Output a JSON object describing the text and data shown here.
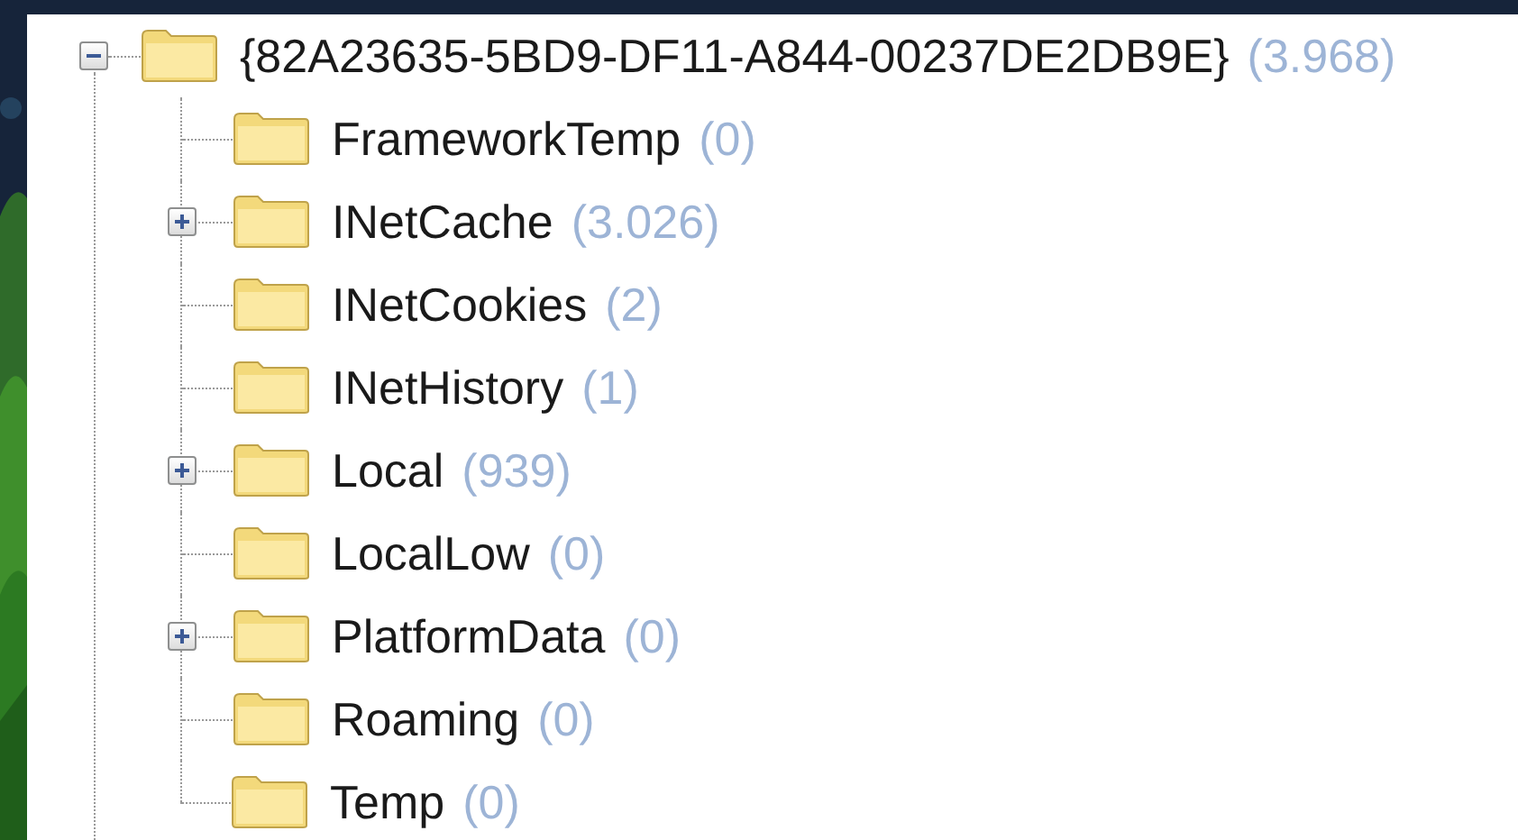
{
  "tree": {
    "name": "{82A23635-5BD9-DF11-A844-00237DE2DB9E}",
    "count": "(3.968)",
    "expanded": true,
    "children": [
      {
        "name": "FrameworkTemp",
        "count": "(0)",
        "expandable": false
      },
      {
        "name": "INetCache",
        "count": "(3.026)",
        "expandable": true
      },
      {
        "name": "INetCookies",
        "count": "(2)",
        "expandable": false
      },
      {
        "name": "INetHistory",
        "count": "(1)",
        "expandable": false
      },
      {
        "name": "Local",
        "count": "(939)",
        "expandable": true
      },
      {
        "name": "LocalLow",
        "count": "(0)",
        "expandable": false
      },
      {
        "name": "PlatformData",
        "count": "(0)",
        "expandable": true
      },
      {
        "name": "Roaming",
        "count": "(0)",
        "expandable": false
      },
      {
        "name": "Temp",
        "count": "(0)",
        "expandable": false
      }
    ]
  }
}
